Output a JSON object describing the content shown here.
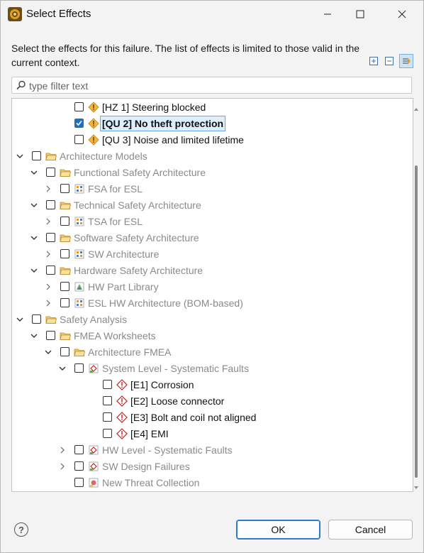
{
  "window": {
    "title": "Select Effects",
    "controls": {
      "minimize": "minimize",
      "maximize": "maximize",
      "close": "close"
    }
  },
  "description": "Select the effects for this failure. The list of effects is limited to those valid in the current context.",
  "filter": {
    "placeholder": "type filter text",
    "value": ""
  },
  "toolbar": {
    "icons": [
      "expand-all-icon",
      "collapse-all-icon",
      "link-selection-icon"
    ]
  },
  "tree": {
    "rows": [
      {
        "label": "[HZ 1] Steering blocked",
        "icon": "warning-icon",
        "checked": false,
        "selected": false,
        "style": "dark"
      },
      {
        "label": "[QU 2] No theft protection",
        "icon": "warning-icon",
        "checked": true,
        "selected": true,
        "style": "dark"
      },
      {
        "label": "[QU 3] Noise and limited lifetime",
        "icon": "warning-icon",
        "checked": false,
        "selected": false,
        "style": "dark"
      },
      {
        "label": "Architecture Models",
        "icon": "folder-icon",
        "checked": false,
        "selected": false,
        "style": "grey"
      },
      {
        "label": "Functional Safety Architecture",
        "icon": "folder-icon",
        "checked": false,
        "selected": false,
        "style": "grey"
      },
      {
        "label": "FSA for ESL",
        "icon": "architecture-icon",
        "checked": false,
        "selected": false,
        "style": "grey"
      },
      {
        "label": "Technical Safety Architecture",
        "icon": "folder-icon",
        "checked": false,
        "selected": false,
        "style": "grey"
      },
      {
        "label": "TSA for ESL",
        "icon": "architecture-icon",
        "checked": false,
        "selected": false,
        "style": "grey"
      },
      {
        "label": "Software Safety Architecture",
        "icon": "folder-icon",
        "checked": false,
        "selected": false,
        "style": "grey"
      },
      {
        "label": "SW Architecture",
        "icon": "architecture-icon",
        "checked": false,
        "selected": false,
        "style": "grey"
      },
      {
        "label": "Hardware Safety Architecture",
        "icon": "folder-icon",
        "checked": false,
        "selected": false,
        "style": "grey"
      },
      {
        "label": "HW Part Library",
        "icon": "part-library-icon",
        "checked": false,
        "selected": false,
        "style": "grey"
      },
      {
        "label": "ESL HW Architecture (BOM-based)",
        "icon": "architecture-icon",
        "checked": false,
        "selected": false,
        "style": "grey"
      },
      {
        "label": "Safety Analysis",
        "icon": "folder-icon",
        "checked": false,
        "selected": false,
        "style": "grey"
      },
      {
        "label": "FMEA Worksheets",
        "icon": "folder-icon",
        "checked": false,
        "selected": false,
        "style": "grey"
      },
      {
        "label": "Architecture FMEA",
        "icon": "folder-icon",
        "checked": false,
        "selected": false,
        "style": "grey"
      },
      {
        "label": "System Level - Systematic Faults",
        "icon": "fmea-icon",
        "checked": false,
        "selected": false,
        "style": "grey"
      },
      {
        "label": "[E1] Corrosion",
        "icon": "effect-icon",
        "checked": false,
        "selected": false,
        "style": "dark"
      },
      {
        "label": "[E2] Loose connector",
        "icon": "effect-icon",
        "checked": false,
        "selected": false,
        "style": "dark"
      },
      {
        "label": "[E3] Bolt and coil not aligned",
        "icon": "effect-icon",
        "checked": false,
        "selected": false,
        "style": "dark"
      },
      {
        "label": "[E4] EMI",
        "icon": "effect-icon",
        "checked": false,
        "selected": false,
        "style": "dark"
      },
      {
        "label": "HW Level - Systematic Faults",
        "icon": "fmea-icon",
        "checked": false,
        "selected": false,
        "style": "grey"
      },
      {
        "label": "SW Design Failures",
        "icon": "fmea-icon",
        "checked": false,
        "selected": false,
        "style": "grey"
      },
      {
        "label": "New Threat Collection",
        "icon": "threat-icon",
        "checked": false,
        "selected": false,
        "style": "grey"
      }
    ]
  },
  "buttons": {
    "ok": "OK",
    "cancel": "Cancel",
    "help": "?"
  },
  "colors": {
    "accent": "#1f6fc7",
    "warning": "#f0a030",
    "effect": "#d03030"
  }
}
